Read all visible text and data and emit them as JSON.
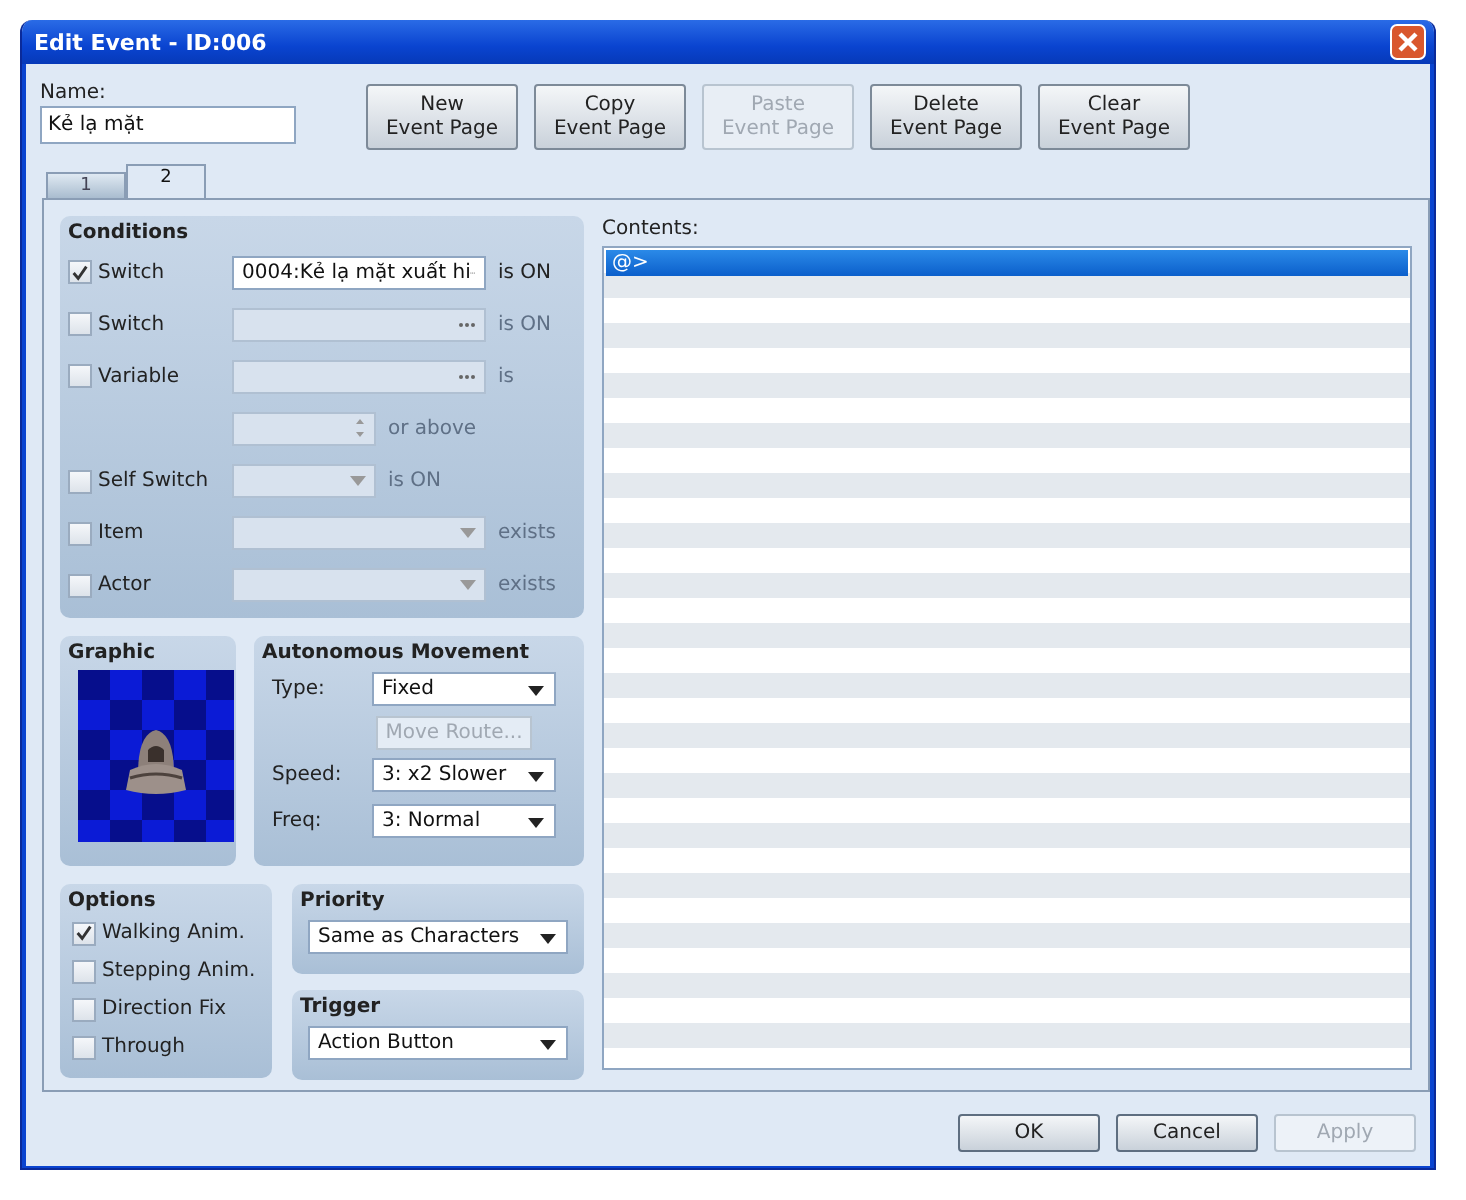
{
  "window": {
    "title": "Edit Event - ID:006"
  },
  "name": {
    "label": "Name:",
    "value": "Kẻ lạ mặt"
  },
  "page_buttons": [
    {
      "label": "New\nEvent Page",
      "disabled": false
    },
    {
      "label": "Copy\nEvent Page",
      "disabled": false
    },
    {
      "label": "Paste\nEvent Page",
      "disabled": true
    },
    {
      "label": "Delete\nEvent Page",
      "disabled": false
    },
    {
      "label": "Clear\nEvent Page",
      "disabled": false
    }
  ],
  "tabs": [
    {
      "label": "1",
      "selected": false
    },
    {
      "label": "2",
      "selected": true
    }
  ],
  "conditions": {
    "title": "Conditions",
    "rows": [
      {
        "kind": "dots",
        "label": "Switch",
        "checked": true,
        "value": "0004:Kẻ lạ mặt xuất hi",
        "suffix": "is ON"
      },
      {
        "kind": "dots",
        "label": "Switch",
        "checked": false,
        "suffix": "is ON"
      },
      {
        "kind": "dots",
        "label": "Variable",
        "checked": false,
        "suffix": "is"
      },
      {
        "kind": "spin",
        "suffix": "or above"
      },
      {
        "kind": "short-dropdown",
        "label": "Self Switch",
        "checked": false,
        "suffix": "is ON"
      },
      {
        "kind": "dropdown",
        "label": "Item",
        "checked": false,
        "suffix": "exists"
      },
      {
        "kind": "dropdown",
        "label": "Actor",
        "checked": false,
        "suffix": "exists"
      }
    ]
  },
  "graphic": {
    "title": "Graphic"
  },
  "movement": {
    "title": "Autonomous Movement",
    "type": {
      "label": "Type:",
      "value": "Fixed"
    },
    "move_route": {
      "label": "Move Route...",
      "disabled": true
    },
    "speed": {
      "label": "Speed:",
      "value": "3: x2 Slower"
    },
    "freq": {
      "label": "Freq:",
      "value": "3: Normal"
    }
  },
  "options": {
    "title": "Options",
    "items": [
      {
        "label": "Walking Anim.",
        "checked": true
      },
      {
        "label": "Stepping Anim.",
        "checked": false
      },
      {
        "label": "Direction Fix",
        "checked": false
      },
      {
        "label": "Through",
        "checked": false
      }
    ]
  },
  "priority": {
    "title": "Priority",
    "value": "Same as Characters"
  },
  "trigger": {
    "title": "Trigger",
    "value": "Action Button"
  },
  "contents": {
    "label": "Contents:",
    "rows": [
      {
        "text": "@>",
        "selected": true
      }
    ]
  },
  "footer_buttons": [
    {
      "label": "OK",
      "disabled": false
    },
    {
      "label": "Cancel",
      "disabled": false
    },
    {
      "label": "Apply",
      "disabled": true
    }
  ]
}
